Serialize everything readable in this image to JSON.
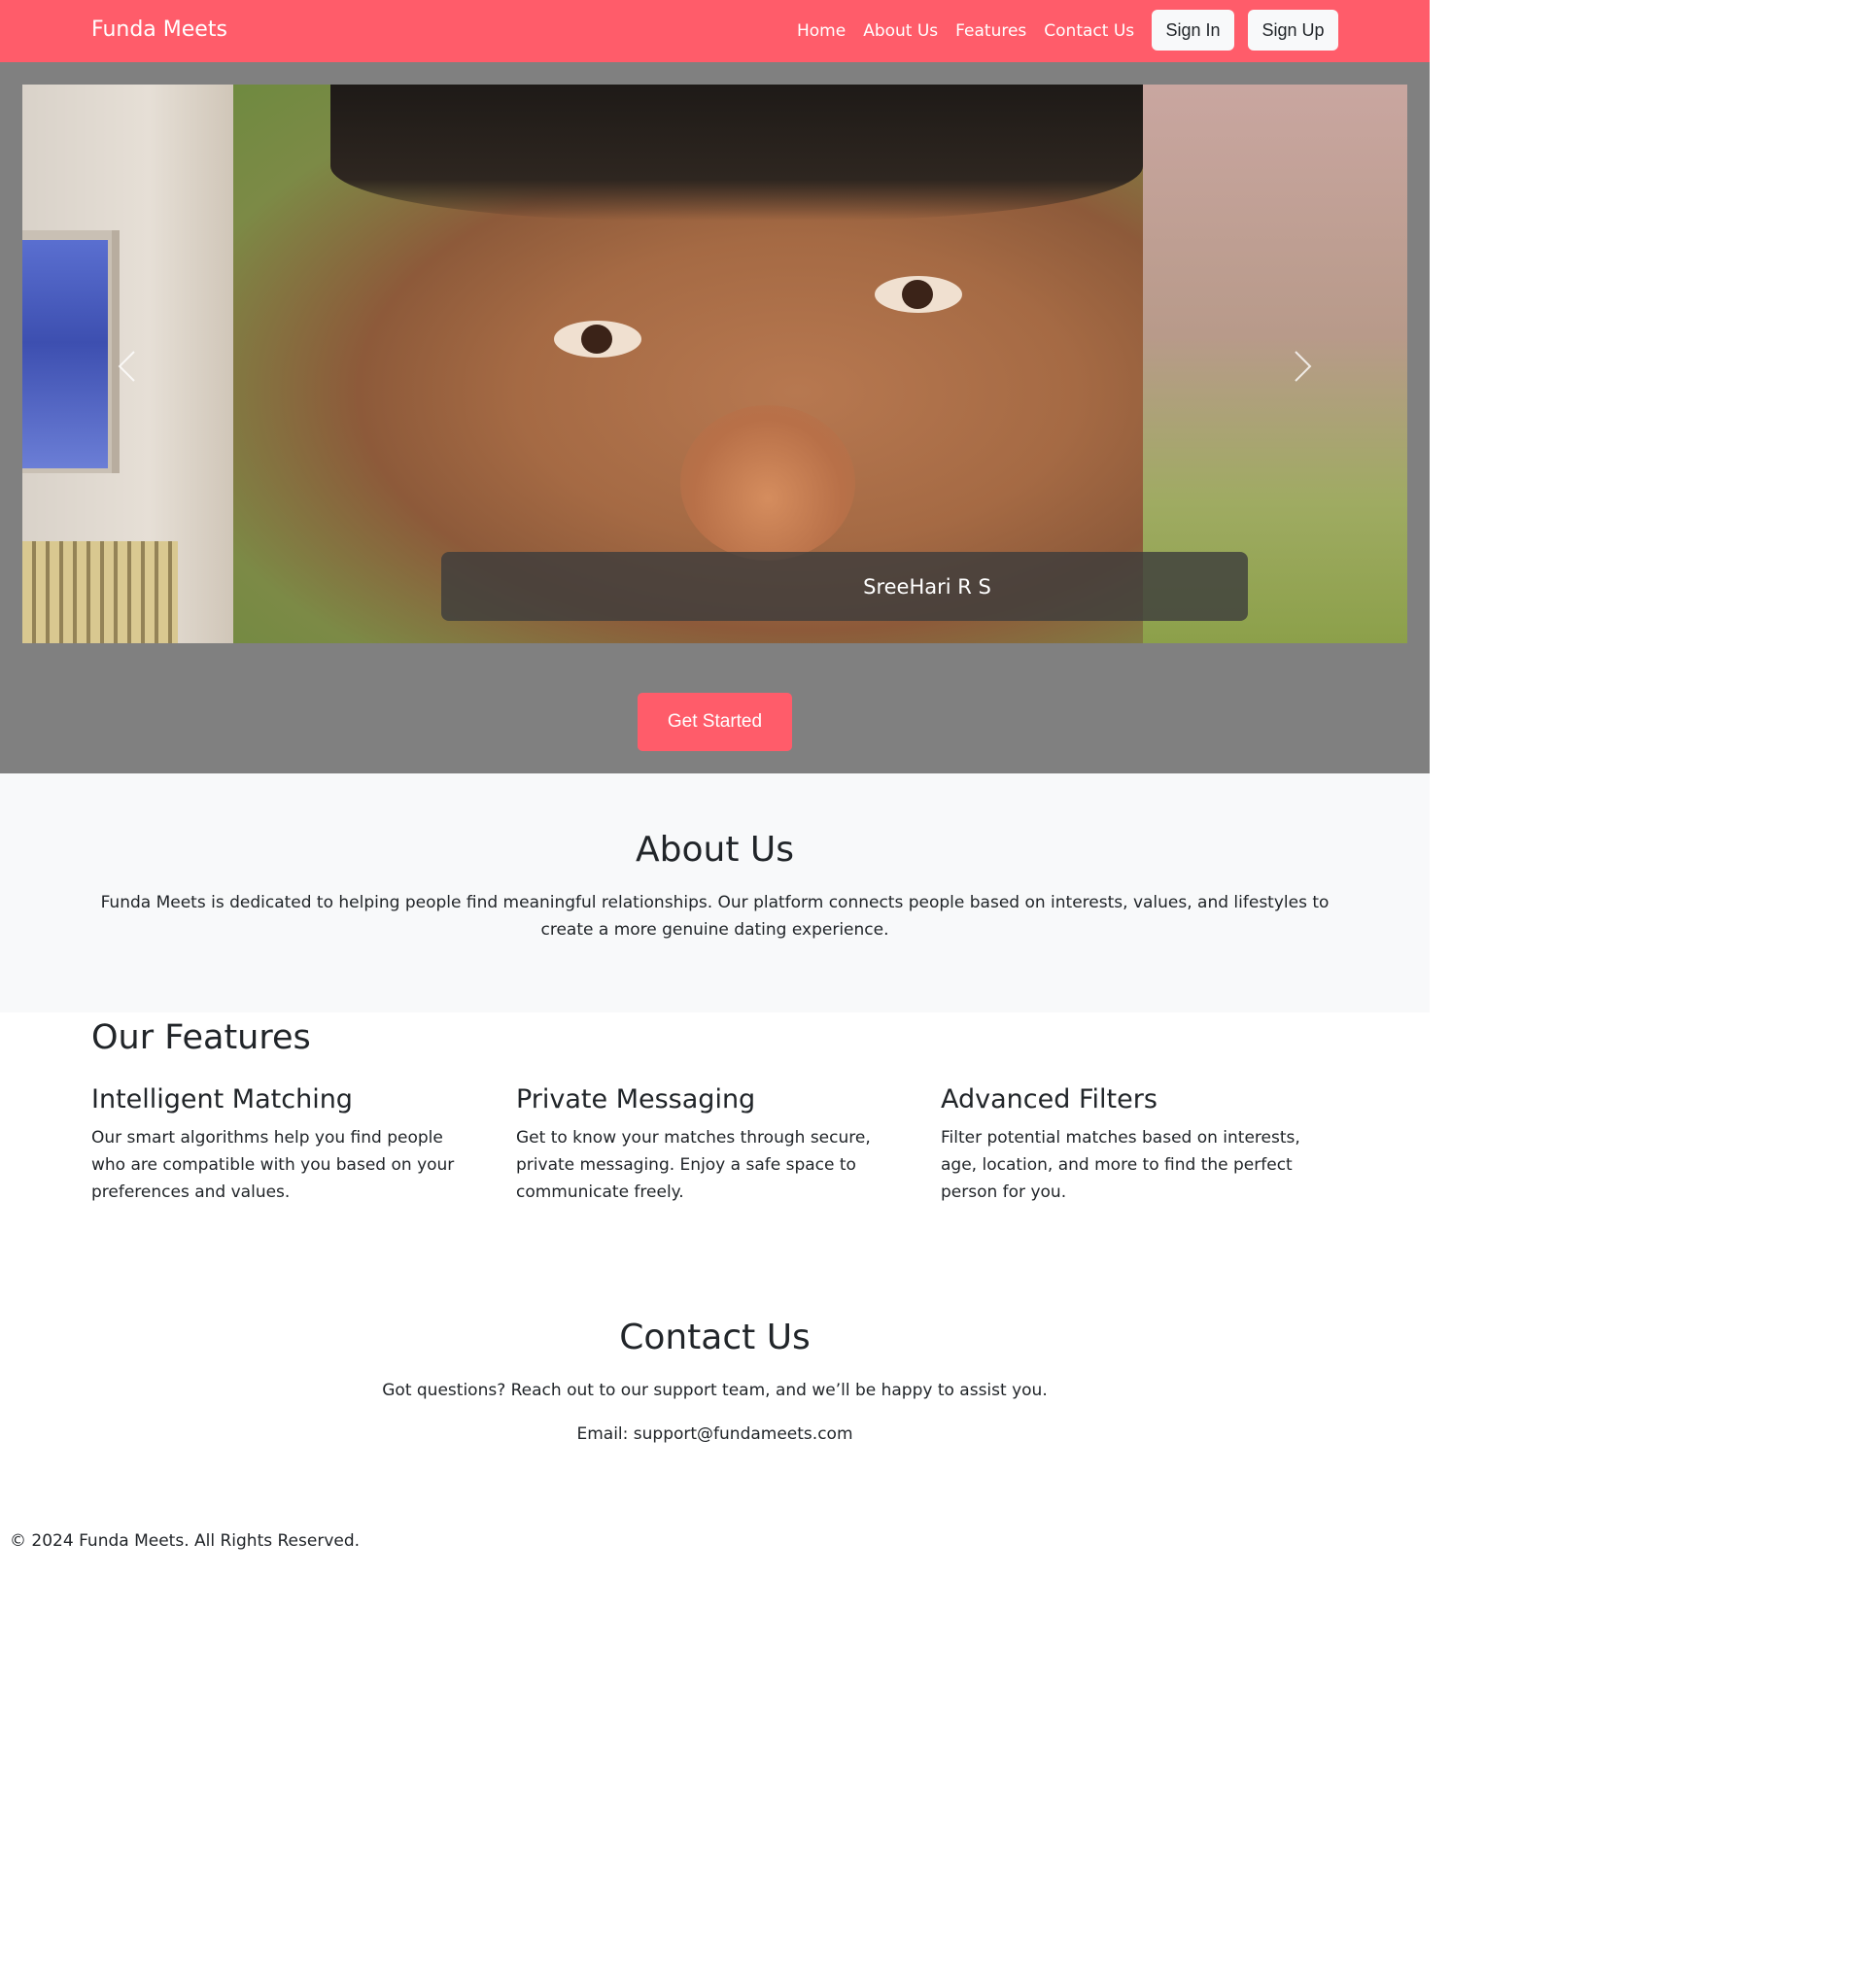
{
  "colors": {
    "brand": "#ff5c6a",
    "hero_bg": "#808080",
    "about_bg": "#f8f9fa"
  },
  "navbar": {
    "brand": "Funda Meets",
    "links": [
      "Home",
      "About Us",
      "Features",
      "Contact Us"
    ],
    "sign_in": "Sign In",
    "sign_up": "Sign Up"
  },
  "hero": {
    "caption": "SreeHari R S",
    "prev_icon": "chevron-left-icon",
    "next_icon": "chevron-right-icon",
    "cta": "Get Started"
  },
  "about": {
    "title": "About Us",
    "text": "Funda Meets is dedicated to helping people find meaningful relationships. Our platform connects people based on interests, values, and lifestyles to create a more genuine dating experience."
  },
  "features": {
    "title": "Our Features",
    "items": [
      {
        "title": "Intelligent Matching",
        "text": "Our smart algorithms help you find people who are compatible with you based on your preferences and values."
      },
      {
        "title": "Private Messaging",
        "text": "Get to know your matches through secure, private messaging. Enjoy a safe space to communicate freely."
      },
      {
        "title": "Advanced Filters",
        "text": "Filter potential matches based on interests, age, location, and more to find the perfect person for you."
      }
    ]
  },
  "contact": {
    "title": "Contact Us",
    "text": "Got questions? Reach out to our support team, and we’ll be happy to assist you.",
    "email": "Email: support@fundameets.com"
  },
  "footer": {
    "text": "© 2024 Funda Meets. All Rights Reserved."
  }
}
